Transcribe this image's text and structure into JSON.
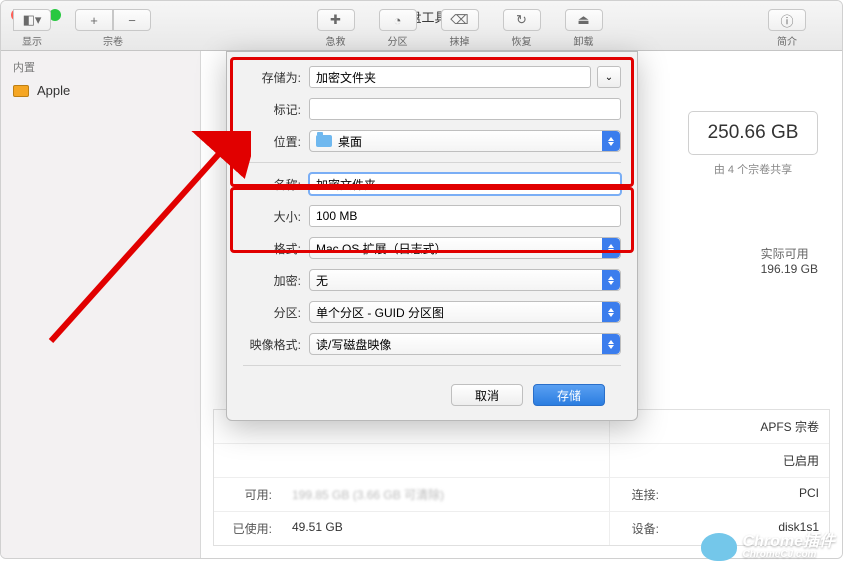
{
  "title": "磁盘工具",
  "toolbar": {
    "view_label": "显示",
    "volume_label": "宗卷",
    "firstaid_label": "急救",
    "partition_label": "分区",
    "erase_label": "抹掉",
    "restore_label": "恢复",
    "unmount_label": "卸载",
    "info_label": "简介"
  },
  "sidebar": {
    "section": "内置",
    "item0": "Apple"
  },
  "capacity": {
    "value": "250.66 GB",
    "sub": "由 4 个宗卷共享"
  },
  "info_right": {
    "actual_label": "实际可用",
    "actual_value": "196.19 GB"
  },
  "sheet": {
    "save_as_label": "存储为:",
    "save_as_value": "加密文件夹",
    "tags_label": "标记:",
    "tags_value": "",
    "location_label": "位置:",
    "location_value": "桌面",
    "name_label": "名称:",
    "name_value": "加密文件夹",
    "size_label": "大小:",
    "size_value": "100 MB",
    "format_label": "格式:",
    "format_value": "Mac OS 扩展（日志式）",
    "encrypt_label": "加密:",
    "encrypt_value": "无",
    "partition_label": "分区:",
    "partition_value": "单个分区 - GUID 分区图",
    "image_format_label": "映像格式:",
    "image_format_value": "读/写磁盘映像",
    "cancel": "取消",
    "save": "存储"
  },
  "table": {
    "r1_l": "可用:",
    "r1_v": "199.85 GB (3.66 GB 可清除)",
    "r2_l": "已使用:",
    "r2_v": "49.51 GB",
    "r1_l2": "连接:",
    "r1_v2": "PCI",
    "r2_l2": "设备:",
    "r2_v2": "disk1s1",
    "r0_v2a": "APFS 宗卷",
    "r0_v2b": "已启用"
  },
  "watermark": {
    "line1": "Chrome插件",
    "line2": "ChromeCJ.com"
  }
}
